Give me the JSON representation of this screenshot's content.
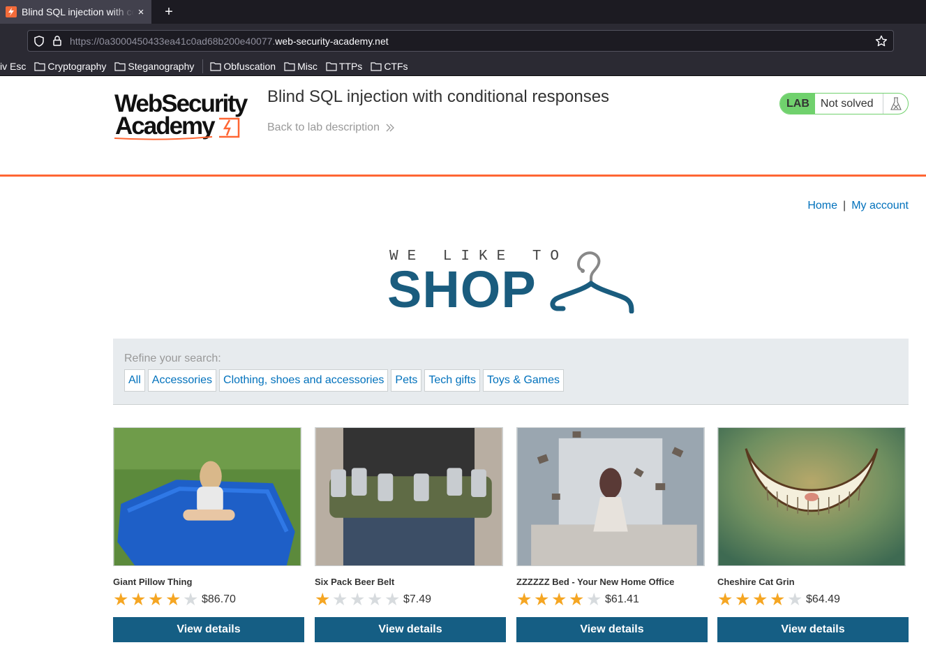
{
  "browser": {
    "tab_title": "Blind SQL injection with conditional responses",
    "tab_close": "×",
    "new_tab": "+",
    "url_dim": "https://0a3000450433ea41c0ad68b200e40077.",
    "url_main": "web-security-academy.net",
    "bookmarks": [
      "iv Esc",
      "Cryptography",
      "Steganography",
      "Obfuscation",
      "Misc",
      "TTPs",
      "CTFs"
    ]
  },
  "lab": {
    "logo_line1": "WebSecurity",
    "logo_line2": "Academy",
    "title": "Blind SQL injection with conditional responses",
    "back_link": "Back to lab description",
    "badge": "LAB",
    "status": "Not solved",
    "accent_color": "#ff6633",
    "status_color": "#70d16d"
  },
  "nav": {
    "home": "Home",
    "separator": "|",
    "account": "My account"
  },
  "banner": {
    "small": "WE LIKE TO",
    "big": "SHOP"
  },
  "filter": {
    "label": "Refine your search:",
    "categories": [
      "All",
      "Accessories",
      "Clothing, shoes and accessories",
      "Pets",
      "Tech gifts",
      "Toys & Games"
    ]
  },
  "products": [
    {
      "name": "Giant Pillow Thing",
      "rating": 4,
      "price": "$86.70",
      "button": "View details"
    },
    {
      "name": "Six Pack Beer Belt",
      "rating": 1,
      "price": "$7.49",
      "button": "View details"
    },
    {
      "name": "ZZZZZZ Bed - Your New Home Office",
      "rating": 4,
      "price": "$61.41",
      "button": "View details"
    },
    {
      "name": "Cheshire Cat Grin",
      "rating": 4,
      "price": "$64.49",
      "button": "View details"
    }
  ]
}
